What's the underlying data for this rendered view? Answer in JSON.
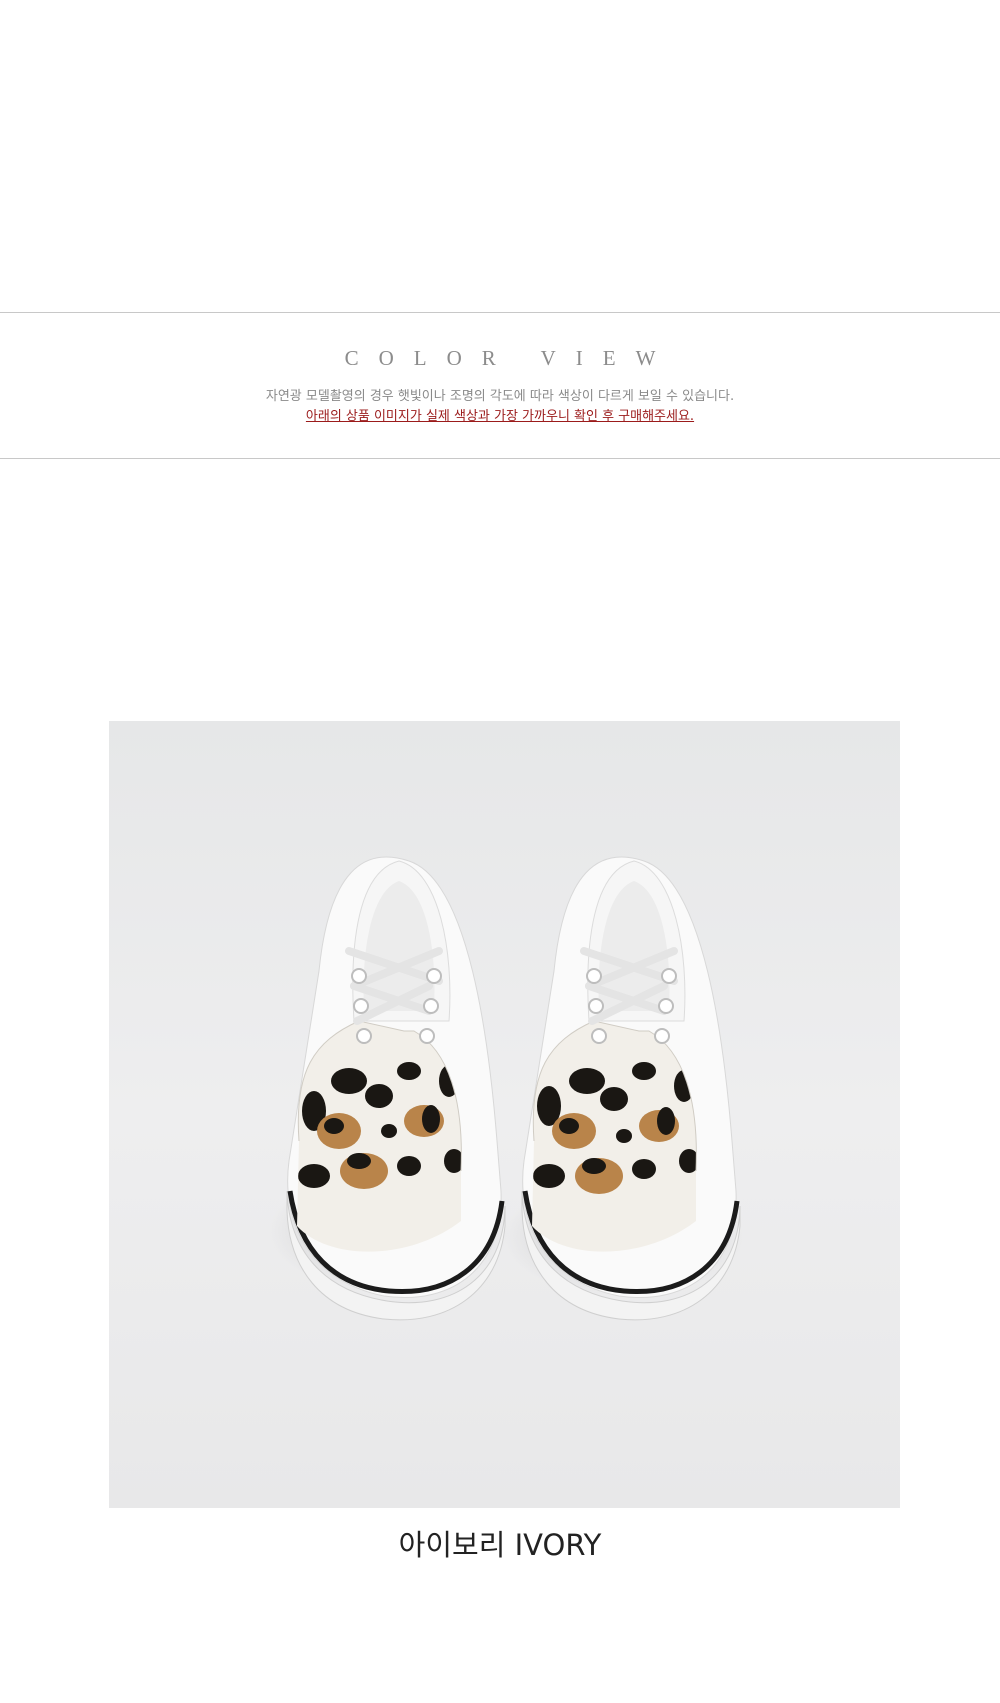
{
  "section": {
    "heading": "COLOR VIEW",
    "notice_line1": "자연광 모델촬영의 경우 햇빛이나 조명의 각도에 따라 색상이 다르게 보일 수 있습니다.",
    "notice_line2": "아래의 상품 이미지가 실제 색상과 가장 가까우니 확인 후 구매해주세요."
  },
  "product": {
    "image": "leopard-print-sneakers-photo",
    "caption": "아이보리 IVORY"
  },
  "colors": {
    "notice_emphasis": "#9b1b1b",
    "heading": "#8c8c8c"
  }
}
